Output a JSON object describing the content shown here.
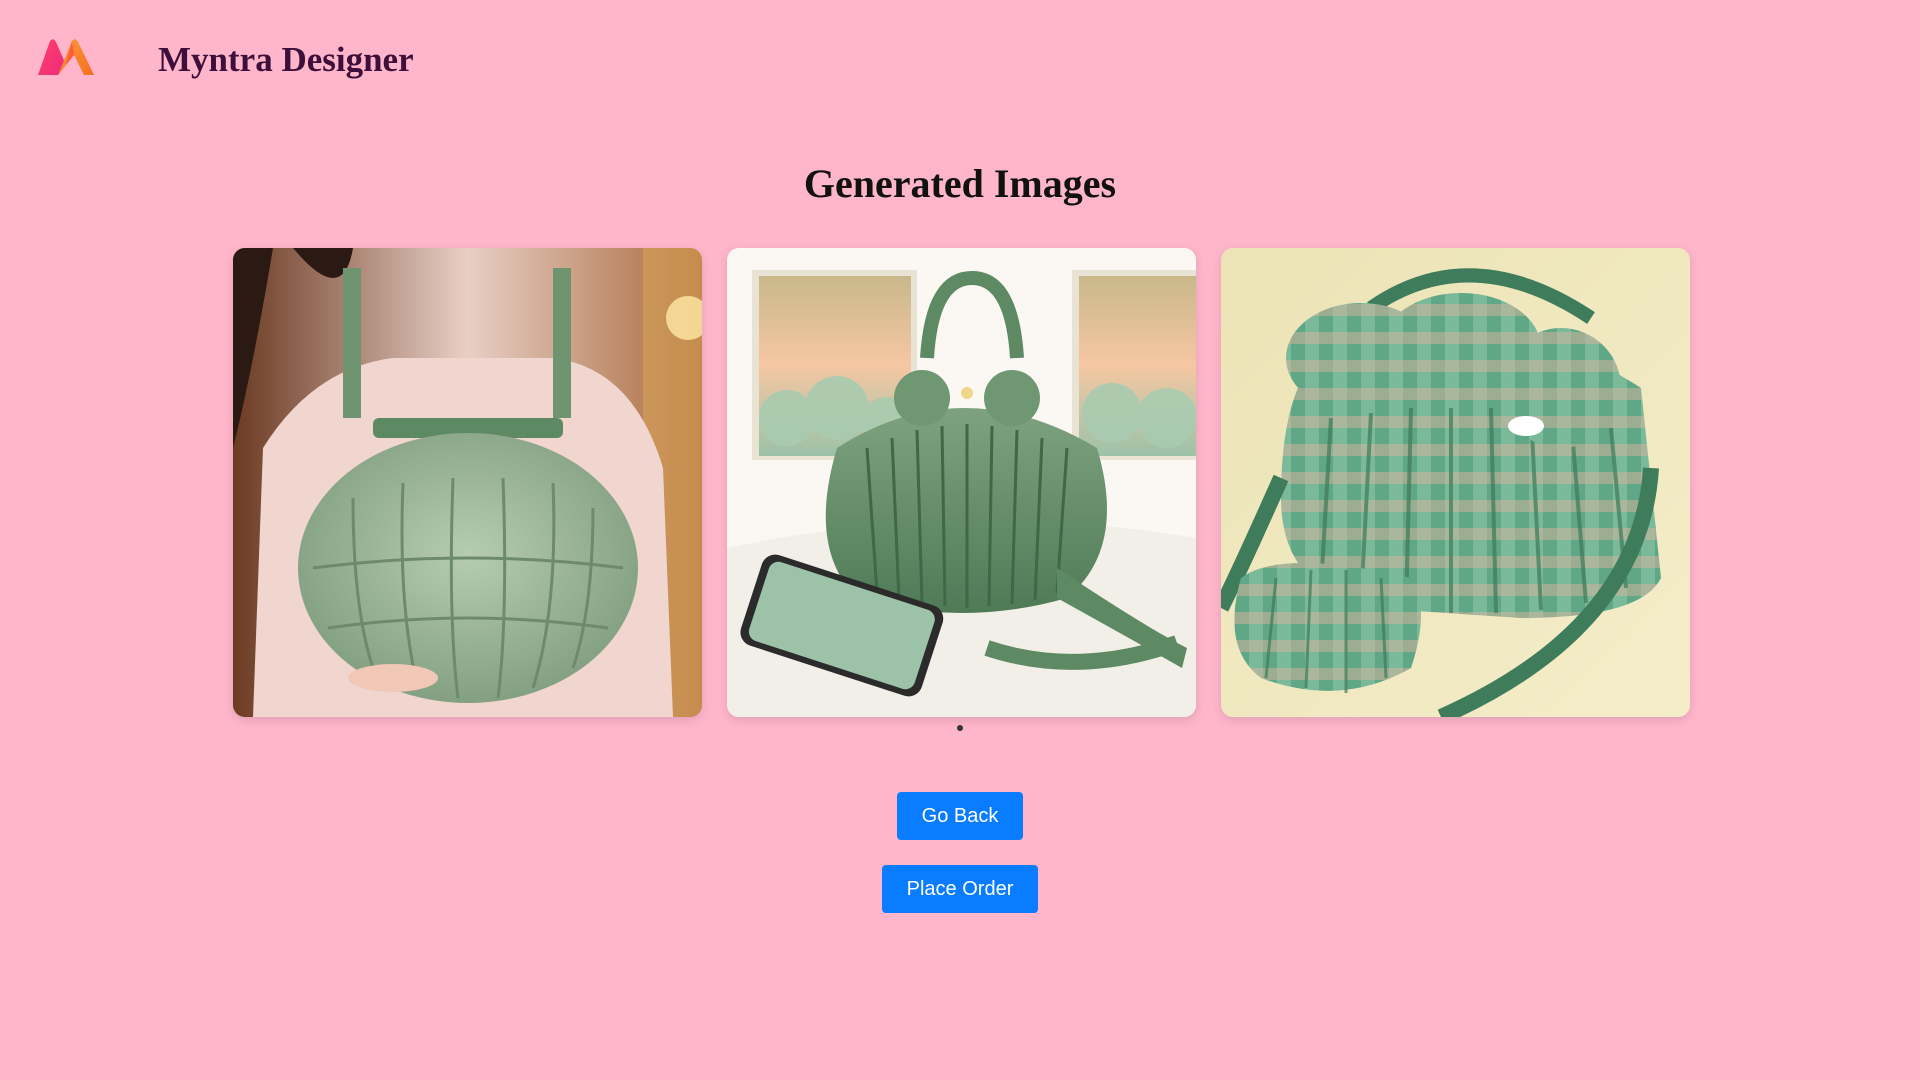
{
  "header": {
    "brand": "Myntra Designer",
    "logo_icon": "myntra-m-logo"
  },
  "main": {
    "heading": "Generated Images",
    "images": [
      {
        "icon": "green-puffy-bag-worn-by-woman-image"
      },
      {
        "icon": "green-pleated-handbag-with-phone-image"
      },
      {
        "icon": "green-plaid-puffy-crossbody-bag-image"
      }
    ],
    "carousel_dots": 1,
    "buttons": {
      "go_back": "Go Back",
      "place_order": "Place Order"
    }
  },
  "colors": {
    "background": "#ffb6cb",
    "button": "#0a7cff",
    "brand_text": "#3d0f3a"
  }
}
